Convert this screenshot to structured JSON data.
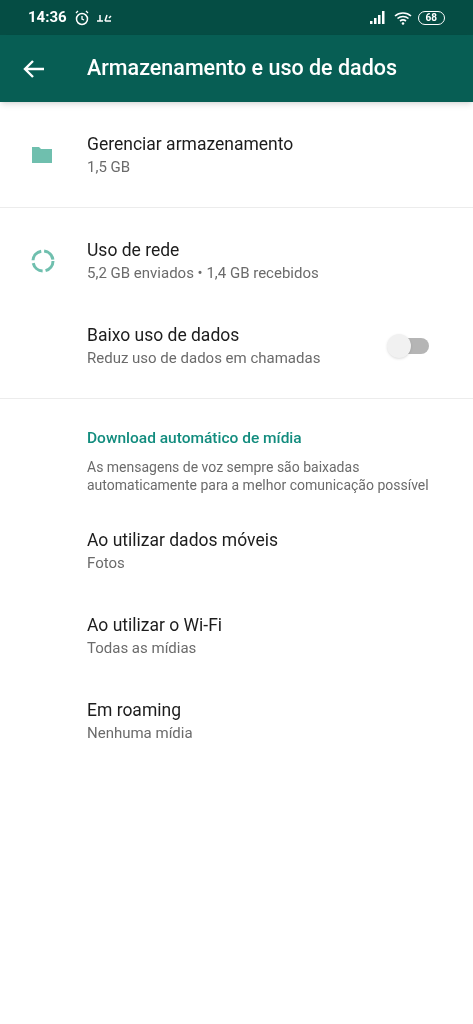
{
  "status_bar": {
    "time": "14:36",
    "battery": "68"
  },
  "toolbar": {
    "title": "Armazenamento e uso de dados"
  },
  "sections": [
    {
      "items": [
        {
          "kind": "storage",
          "title": "Gerenciar armazenamento",
          "subtitle": "1,5 GB"
        }
      ]
    },
    {
      "items": [
        {
          "kind": "network",
          "title": "Uso de rede",
          "subtitle": "5,2 GB enviados • 1,4 GB recebidos"
        },
        {
          "kind": "toggle",
          "title": "Baixo uso de dados",
          "subtitle": "Reduz uso de dados em chamadas",
          "on": false
        }
      ]
    },
    {
      "header": "Download automático de mídia",
      "note": "As mensagens de voz sempre são baixadas automaticamente para a melhor comunicação possível",
      "items": [
        {
          "kind": "setting",
          "title": "Ao utilizar dados móveis",
          "subtitle": "Fotos"
        },
        {
          "kind": "setting",
          "title": "Ao utilizar o Wi-Fi",
          "subtitle": "Todas as mídias"
        },
        {
          "kind": "setting",
          "title": "Em roaming",
          "subtitle": "Nenhuma mídia"
        }
      ]
    }
  ]
}
